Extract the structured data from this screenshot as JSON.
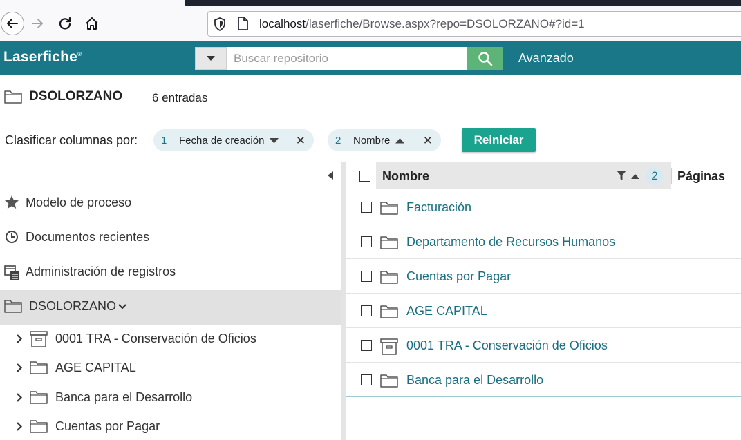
{
  "browser": {
    "url_host": "localhost",
    "url_path": "/laserfiche/Browse.aspx?repo=DSOLORZANO#?id=1"
  },
  "header": {
    "logo": "Laserfiche",
    "search_placeholder": "Buscar repositorio",
    "advanced_label": "Avanzado",
    "accent_color": "#1a7788"
  },
  "breadcrumb": {
    "title": "DSOLORZANO",
    "count": "6 entradas"
  },
  "sort": {
    "label": "Clasificar columnas por:",
    "chips": [
      {
        "num": "1",
        "label": "Fecha de creación",
        "direction": "desc"
      },
      {
        "num": "2",
        "label": "Nombre",
        "direction": "asc"
      }
    ],
    "reset_label": "Reiniciar"
  },
  "sidebar": {
    "items": [
      {
        "label": "Modelo de proceso",
        "icon": "star-icon"
      },
      {
        "label": "Documentos recientes",
        "icon": "clock-icon"
      },
      {
        "label": "Administración de registros",
        "icon": "records-icon"
      }
    ],
    "repo": {
      "label": "DSOLORZANO",
      "icon": "folder-icon"
    },
    "tree": [
      {
        "label": "0001 TRA - Conservación de Oficios",
        "icon": "record-box-icon"
      },
      {
        "label": "AGE CAPITAL",
        "icon": "folder-icon"
      },
      {
        "label": "Banca para el Desarrollo",
        "icon": "folder-icon"
      },
      {
        "label": "Cuentas por Pagar",
        "icon": "folder-icon"
      }
    ]
  },
  "list": {
    "columns": {
      "name": "Nombre",
      "rank": "2",
      "pages": "Páginas"
    },
    "rows": [
      {
        "name": "Facturación",
        "icon": "folder-icon"
      },
      {
        "name": "Departamento de Recursos Humanos",
        "icon": "folder-icon"
      },
      {
        "name": "Cuentas por Pagar",
        "icon": "folder-icon"
      },
      {
        "name": "AGE CAPITAL",
        "icon": "folder-icon"
      },
      {
        "name": "0001 TRA - Conservación de Oficios",
        "icon": "record-box-icon"
      },
      {
        "name": "Banca para el Desarrollo",
        "icon": "folder-icon"
      }
    ]
  }
}
